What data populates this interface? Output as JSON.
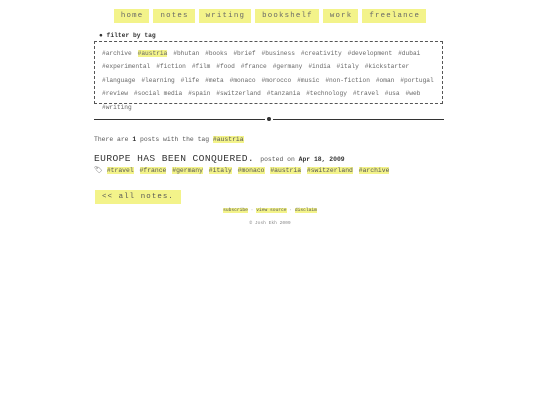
{
  "nav": {
    "items": [
      "home",
      "notes",
      "writing",
      "bookshelf",
      "work",
      "freelance"
    ]
  },
  "filter": {
    "title": "● filter by tag",
    "tags": [
      "#archive",
      "#austria",
      "#bhutan",
      "#books",
      "#brief",
      "#business",
      "#creativity",
      "#development",
      "#dubai",
      "#experimental",
      "#fiction",
      "#film",
      "#food",
      "#france",
      "#germany",
      "#india",
      "#italy",
      "#kickstarter",
      "#language",
      "#learning",
      "#life",
      "#meta",
      "#monaco",
      "#morocco",
      "#music",
      "#non-fiction",
      "#oman",
      "#portugal",
      "#review",
      "#social media",
      "#spain",
      "#switzerland",
      "#tanzania",
      "#technology",
      "#travel",
      "#usa",
      "#web",
      "#writing"
    ],
    "selected": "#austria"
  },
  "results": {
    "prefix": "There are",
    "count": "1",
    "middle": "posts with the tag",
    "tag": "#austria"
  },
  "post": {
    "title": "EUROPE HAS BEEN CONQUERED.",
    "posted_on": "posted on",
    "date": "Apr 18, 2009",
    "tags": [
      "#travel",
      "#france",
      "#germany",
      "#italy",
      "#monaco",
      "#austria",
      "#switzerland",
      "#archive"
    ]
  },
  "back_label": "<< all notes.",
  "footer": {
    "links": [
      "subscribe",
      "view source",
      "disclaim"
    ],
    "separator": "·",
    "copyright": "© Josh Ekh 2009"
  },
  "colors": {
    "highlight": "#f3f38a",
    "text": "#555555"
  },
  "icons": {
    "tag": "tag-icon",
    "bullet": "bullet-icon"
  }
}
